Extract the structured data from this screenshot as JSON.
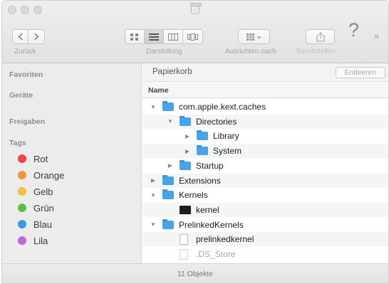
{
  "toolbar": {
    "back_label": "Zurück",
    "view_label": "Darstellung",
    "arrange_label": "Ausrichten nach",
    "share_label": "Bereitstellen",
    "help_symbol": "?",
    "overflow_symbol": "»"
  },
  "sidebar": {
    "favorites_header": "Favoriten",
    "devices_header": "Geräte",
    "shared_header": "Freigaben",
    "tags_header": "Tags",
    "tags": [
      {
        "label": "Rot",
        "color": "#f0434a"
      },
      {
        "label": "Orange",
        "color": "#f3963a"
      },
      {
        "label": "Gelb",
        "color": "#eec43e"
      },
      {
        "label": "Grün",
        "color": "#56c24b"
      },
      {
        "label": "Blau",
        "color": "#3a9be5"
      },
      {
        "label": "Lila",
        "color": "#b86ad8"
      }
    ]
  },
  "content": {
    "location": "Papierkorb",
    "empty_button": "Entleeren",
    "column_name": "Name",
    "rows": [
      {
        "name": "com.apple.kext.caches",
        "icon": "folder-icon",
        "expanded": true
      },
      {
        "name": "Directories",
        "icon": "folder-icon",
        "expanded": true
      },
      {
        "name": "Library",
        "icon": "folder-icon",
        "expanded": false
      },
      {
        "name": "System",
        "icon": "folder-icon",
        "expanded": false
      },
      {
        "name": "Startup",
        "icon": "folder-icon",
        "expanded": false
      },
      {
        "name": "Extensions",
        "icon": "folder-icon",
        "expanded": false
      },
      {
        "name": "Kernels",
        "icon": "folder-icon",
        "expanded": true
      },
      {
        "name": "kernel",
        "icon": "executable-icon"
      },
      {
        "name": "PrelinkedKernels",
        "icon": "folder-icon",
        "expanded": true
      },
      {
        "name": "prelinkedkernel",
        "icon": "document-icon"
      },
      {
        "name": ".DS_Store",
        "icon": "hidden-file-icon"
      }
    ]
  },
  "status": {
    "item_count": "11 Objekte"
  }
}
